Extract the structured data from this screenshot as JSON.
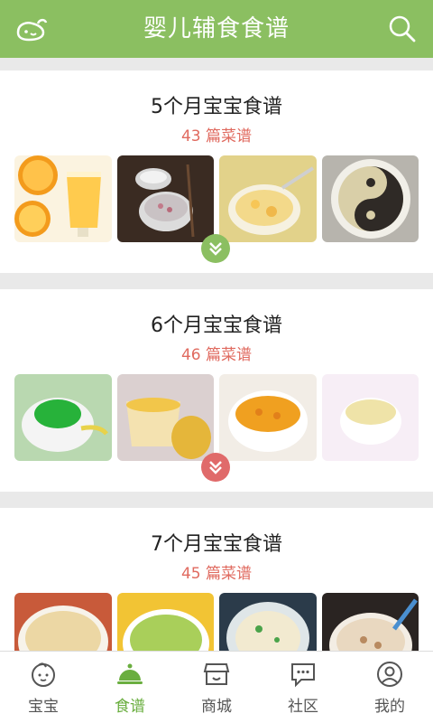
{
  "header": {
    "title": "婴儿辅食食谱",
    "logo_icon": "baby-whale-icon",
    "search_icon": "search-icon"
  },
  "sections": [
    {
      "title": "5个月宝宝食谱",
      "count": "43 篇菜谱",
      "expand_color": "#8bbf61",
      "thumbs": [
        "orange-juice",
        "rice-porridge-bowl",
        "egg-custard",
        "black-sesame-paste"
      ]
    },
    {
      "title": "6个月宝宝食谱",
      "count": "46 篇菜谱",
      "expand_color": "#e06a6a",
      "thumbs": [
        "green-puree",
        "mango-puree",
        "carrot-soup",
        "rice-cereal"
      ]
    },
    {
      "title": "7个月宝宝食谱",
      "count": "45 篇菜谱",
      "expand_color": "#8bbf61",
      "thumbs": [
        "millet-porridge",
        "vegetable-porridge",
        "mashed-potato",
        "meat-porridge"
      ]
    }
  ],
  "tabs": [
    {
      "label": "宝宝",
      "icon": "baby-face-icon"
    },
    {
      "label": "食谱",
      "icon": "cloche-icon",
      "active": true
    },
    {
      "label": "商城",
      "icon": "shop-icon"
    },
    {
      "label": "社区",
      "icon": "chat-bubble-icon"
    },
    {
      "label": "我的",
      "icon": "user-icon"
    }
  ],
  "colors": {
    "accent": "#8bbf61",
    "count_red": "#e06a5f",
    "active_tab": "#6aae3f"
  }
}
